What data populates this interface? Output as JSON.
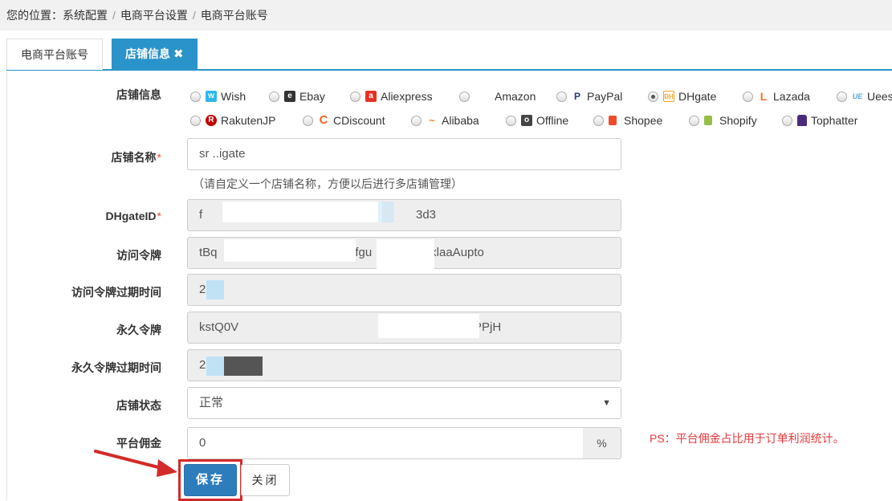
{
  "breadcrumb": {
    "prefix": "您的位置：",
    "items": [
      "系统配置",
      "电商平台设置",
      "电商平台账号"
    ],
    "separator": "/"
  },
  "tabs": [
    {
      "label": "电商平台账号",
      "active": false
    },
    {
      "label": "店铺信息",
      "active": true,
      "close": "✖"
    }
  ],
  "form": {
    "platform": {
      "label": "店铺信息",
      "selected": "DHgate",
      "options": [
        {
          "name": "Wish",
          "icon": "wish-icon",
          "color": "#2fb7ec"
        },
        {
          "name": "Ebay",
          "icon": "ebay-icon",
          "color": "#333333"
        },
        {
          "name": "Aliexpress",
          "icon": "aliexpress-icon",
          "color": "#e43226"
        },
        {
          "name": "Amazon",
          "icon": "amazon-icon",
          "color": "#ffffff"
        },
        {
          "name": "PayPal",
          "icon": "paypal-icon",
          "color": "#253b80"
        },
        {
          "name": "DHgate",
          "icon": "dhgate-icon",
          "color": "#f6a623"
        },
        {
          "name": "Lazada",
          "icon": "lazada-icon",
          "color": "#f57224"
        },
        {
          "name": "Ueeshop",
          "icon": "ueeshop-icon",
          "color": "#5aa3d8"
        },
        {
          "name": "RakutenJP",
          "icon": "rakuten-icon",
          "color": "#bf0000"
        },
        {
          "name": "CDiscount",
          "icon": "cdiscount-icon",
          "color": "#f26522"
        },
        {
          "name": "Alibaba",
          "icon": "alibaba-icon",
          "color": "#ff6a00"
        },
        {
          "name": "Offline",
          "icon": "offline-icon",
          "color": "#444444"
        },
        {
          "name": "Shopee",
          "icon": "shopee-icon",
          "color": "#ee4d2d"
        },
        {
          "name": "Shopify",
          "icon": "shopify-icon",
          "color": "#96bf48"
        },
        {
          "name": "Tophatter",
          "icon": "tophatter-icon",
          "color": "#4a2a7a"
        }
      ]
    },
    "shop_name": {
      "label": "店铺名称",
      "required": "*",
      "value": "sr       ..igate",
      "hint": "（请自定义一个店铺名称，方便以后进行多店铺管理）"
    },
    "dhgate_id": {
      "label": "DHgateID",
      "required": "*",
      "value": "f",
      "value_tail": "3d3"
    },
    "access_token": {
      "label": "访问令牌",
      "value": "tBq",
      "value_mid": "dfgu",
      "value_tail": "/xlaaAupto"
    },
    "access_token_expiry": {
      "label": "访问令牌过期时间",
      "value": "2"
    },
    "permanent_token": {
      "label": "永久令牌",
      "value": "kstQ0V",
      "value_tail": "PPjH"
    },
    "permanent_token_expiry": {
      "label": "永久令牌过期时间",
      "value": "2"
    },
    "shop_status": {
      "label": "店铺状态",
      "value": "正常"
    },
    "commission": {
      "label": "平台佣金",
      "value": "0",
      "unit": "%",
      "note": "PS：平台佣金占比用于订单利润统计。"
    }
  },
  "buttons": {
    "save": "保存",
    "close": "关闭"
  },
  "colors": {
    "accent": "#2a93c9",
    "save": "#2d7dbd",
    "warning": "#e4393c",
    "highlight": "#d32a2a"
  }
}
